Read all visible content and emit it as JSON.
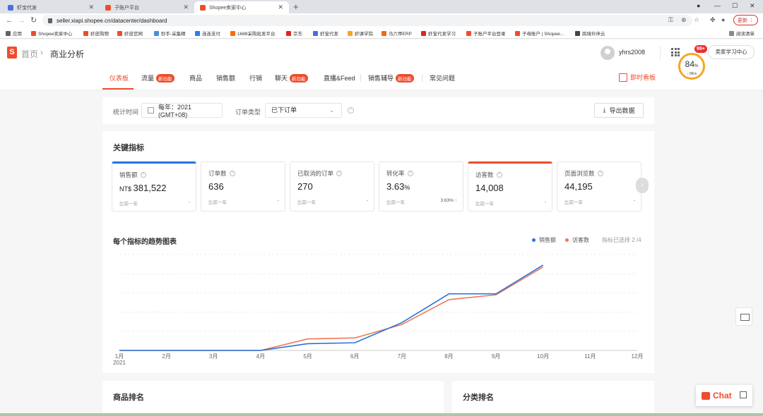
{
  "browser": {
    "tabs": [
      {
        "title": "虾宝代发",
        "color": "#4a6ee0"
      },
      {
        "title": "子账户平台",
        "color": "#ee4d2d"
      },
      {
        "title": "Shopee卖家中心",
        "color": "#ee4d2d",
        "active": true
      }
    ],
    "url": "seller.xiapi.shopee.cn/datacenter/dashboard",
    "update_label": "更新 ⋮",
    "bookmarks": [
      {
        "label": "应用",
        "color": "#5f6368"
      },
      {
        "label": "Shopee卖家中心",
        "color": "#ee4d2d"
      },
      {
        "label": "虾皮购物",
        "color": "#ee4d2d"
      },
      {
        "label": "虾皮官网",
        "color": "#ee4d2d"
      },
      {
        "label": "秒手-采集精",
        "color": "#4a90d9"
      },
      {
        "label": "连连支付",
        "color": "#2a7ee8"
      },
      {
        "label": "1688采购批发平台",
        "color": "#ff6a00"
      },
      {
        "label": "京东",
        "color": "#e1251b"
      },
      {
        "label": "虾宝代发",
        "color": "#4a6ee0"
      },
      {
        "label": "虾课学院",
        "color": "#f5a623"
      },
      {
        "label": "马六甲ERP",
        "color": "#e86c1a"
      },
      {
        "label": "虾宝代发学习",
        "color": "#e1251b"
      },
      {
        "label": "子账户平台登录",
        "color": "#ee4d2d"
      },
      {
        "label": "子母账户 | Shopee...",
        "color": "#ee4d2d"
      },
      {
        "label": "跨境伙伴云",
        "color": "#444"
      }
    ],
    "reading_list": "阅读清单"
  },
  "header": {
    "logo_letter": "S",
    "breadcrumb_home": "首页",
    "breadcrumb_sep": "›",
    "breadcrumb_current": "商业分析",
    "username": "yhrs2008",
    "notify_badge": "99+",
    "learn_button": "卖家学习中心",
    "speed_percent": "84",
    "speed_unit": "%",
    "speed_net": "↓ 0K/s"
  },
  "subnav": {
    "tabs": [
      {
        "label": "仪表板",
        "active": true
      },
      {
        "label": "流量",
        "badge": "新功能"
      },
      {
        "label": "商品"
      },
      {
        "label": "销售额"
      },
      {
        "label": "行销"
      },
      {
        "label": "聊天",
        "badge": "新功能"
      },
      {
        "label": "直播&Feed"
      },
      {
        "label": "销售辅导",
        "badge": "新功能"
      },
      {
        "label": "常见问题"
      }
    ],
    "realtime_label": "即时看板"
  },
  "filter": {
    "time_label": "统计时间",
    "date_value": "每年：2021 (GMT+08)",
    "order_type_label": "订单类型",
    "order_type_value": "已下订单",
    "export_label": "导出数据"
  },
  "metrics": {
    "title": "关键指标",
    "compare_label": "比前一年",
    "items": [
      {
        "name": "销售额",
        "prefix": "NT$ ",
        "value": "381,522",
        "delta": "-",
        "selected": "blue"
      },
      {
        "name": "订单数",
        "value": "636",
        "delta": "-"
      },
      {
        "name": "已取消的订单",
        "value": "270",
        "delta": "-"
      },
      {
        "name": "转化率",
        "value": "3.63",
        "unit": "%",
        "delta": "3.63%",
        "delta_up": true
      },
      {
        "name": "访客数",
        "value": "14,008",
        "delta": "-",
        "selected": "orange"
      },
      {
        "name": "页面浏览数",
        "value": "44,195",
        "delta": "-"
      }
    ]
  },
  "trend": {
    "title": "每个指标的趋势图表",
    "selected_text": "指标已选择 2 /4"
  },
  "chart_data": {
    "type": "line",
    "categories": [
      "1月",
      "2月",
      "3月",
      "4月",
      "5月",
      "6月",
      "7月",
      "8月",
      "9月",
      "10月",
      "11月",
      "12月"
    ],
    "x_sublabel": "2021",
    "ylim": [
      0,
      100
    ],
    "grid": true,
    "legend_position": "top-right",
    "series": [
      {
        "name": "销售额",
        "color": "#2673dd",
        "values": [
          0,
          0,
          0,
          0,
          7,
          8,
          29,
          59,
          59,
          89,
          null,
          null
        ]
      },
      {
        "name": "访客数",
        "color": "#ee7a54",
        "values": [
          0,
          0,
          0,
          0,
          12,
          13,
          27,
          53,
          58,
          87,
          null,
          null
        ]
      }
    ]
  },
  "bottom": {
    "product_rank": "商品排名",
    "category_rank": "分类排名"
  },
  "chat": {
    "label": "Chat"
  }
}
